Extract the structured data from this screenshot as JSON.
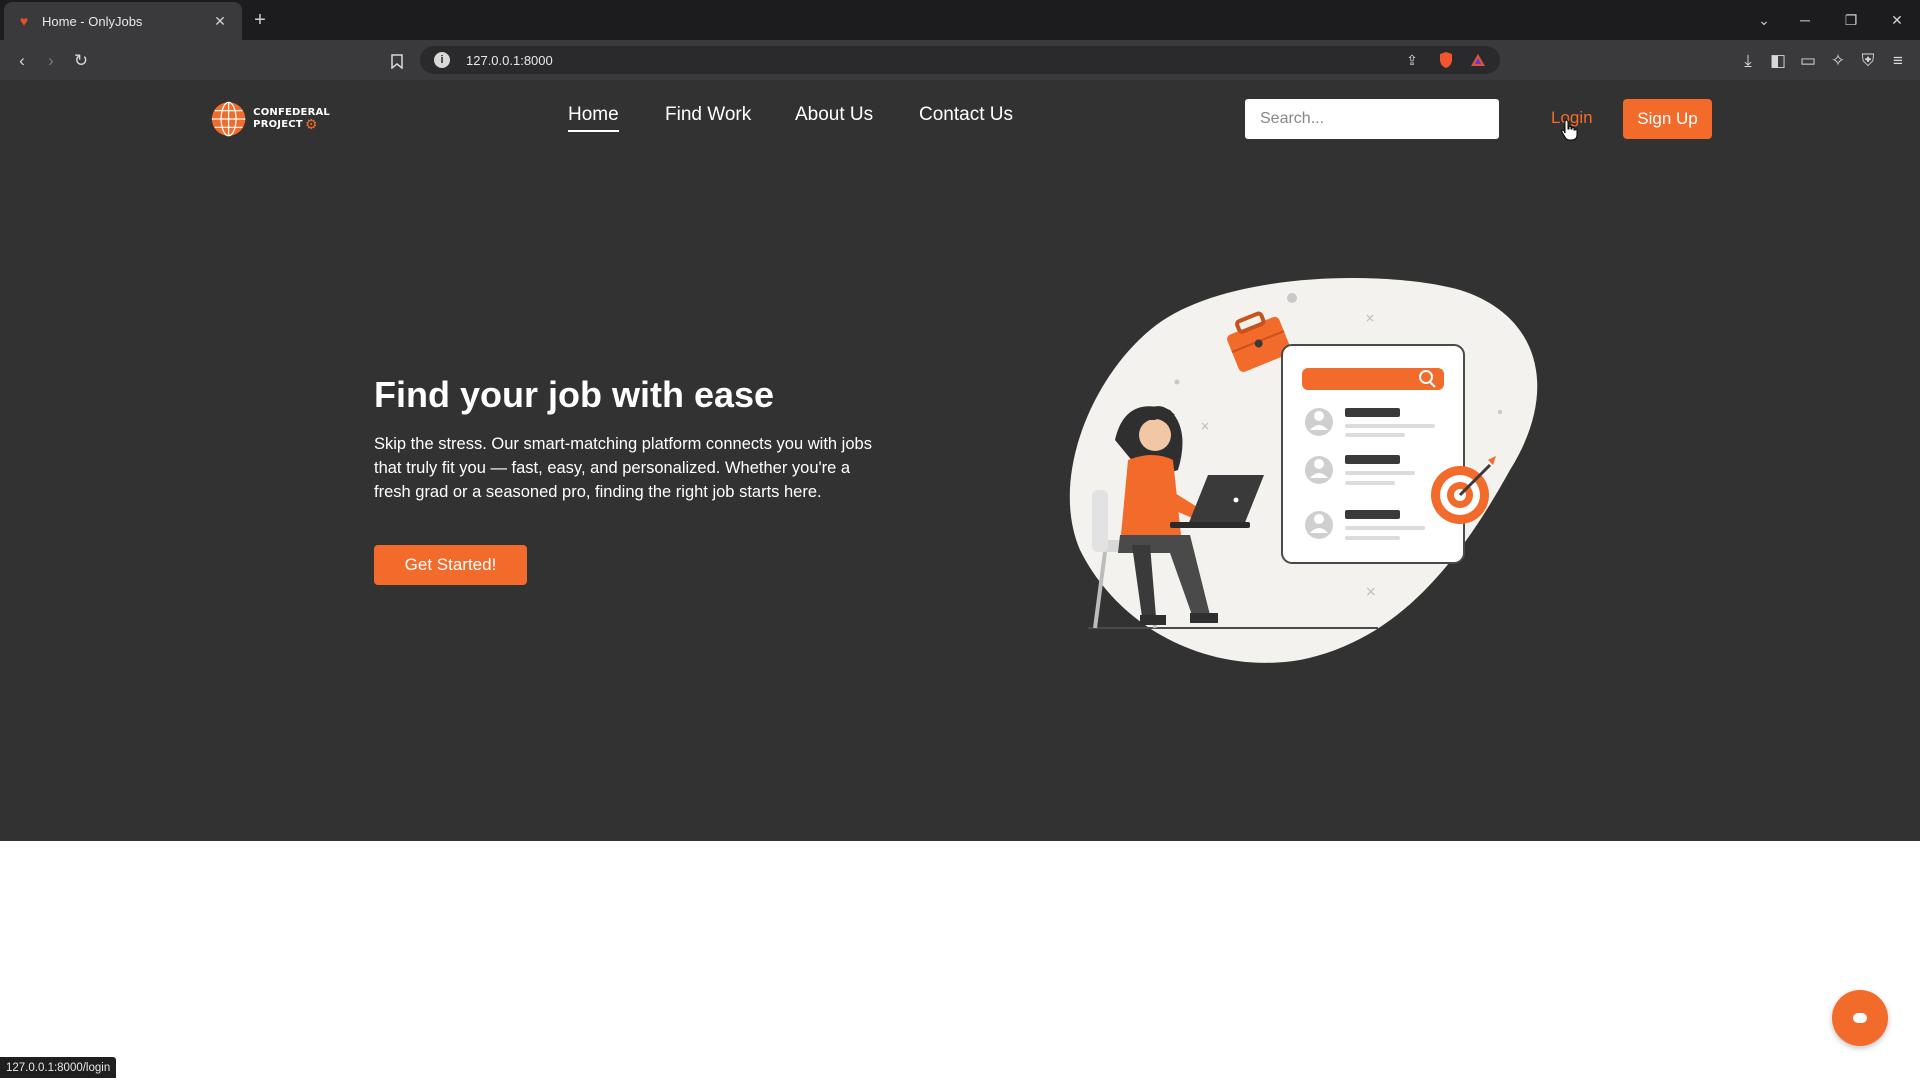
{
  "browser": {
    "tab_title": "Home - OnlyJobs",
    "tab_favicon": "onlyjobs-heart-icon",
    "url": "127.0.0.1:8000",
    "status_url": "127.0.0.1:8000/login"
  },
  "site": {
    "logo_line1": "CONFEDERAL",
    "logo_line2": "PROJECT",
    "nav": [
      {
        "label": "Home",
        "active": true
      },
      {
        "label": "Find Work",
        "active": false
      },
      {
        "label": "About Us",
        "active": false
      },
      {
        "label": "Contact Us",
        "active": false
      }
    ],
    "search_placeholder": "Search...",
    "login_label": "Login",
    "signup_label": "Sign Up"
  },
  "hero": {
    "title": "Find your job with ease",
    "text": "Skip the stress. Our smart-matching platform connects you with jobs that truly fit you — fast, easy, and personalized. Whether you're a fresh grad or a seasoned pro, finding the right job starts here.",
    "cta_label": "Get Started!"
  },
  "colors": {
    "accent": "#f26b2a",
    "page_bg": "#323232",
    "chrome_bg": "#3a3a3c"
  }
}
